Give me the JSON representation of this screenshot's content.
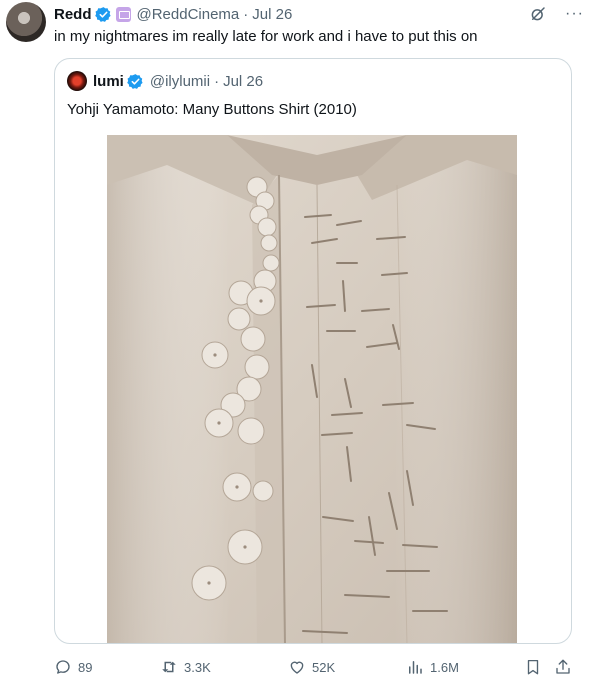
{
  "tweet": {
    "author_name": "Redd",
    "handle": "@ReddCinema",
    "separator": "·",
    "date": "Jul 26",
    "text": "in my nightmares im really late for work and i have to put this on",
    "more": "···"
  },
  "quote": {
    "author_name": "lumi",
    "handle": "@ilylumii",
    "separator": "·",
    "date": "Jul 26",
    "text": "Yohji Yamamoto: Many Buttons Shirt (2010)"
  },
  "actions": {
    "replies": "89",
    "reposts": "3.3K",
    "likes": "52K",
    "views": "1.6M"
  },
  "colors": {
    "verified": "#1d9bf0",
    "muted": "#536471",
    "border": "#cfd9de",
    "shirt": "#d8cfc4"
  },
  "icons": [
    "verified-icon",
    "affiliate-badge-icon",
    "grok-icon",
    "more-icon",
    "reply-icon",
    "repost-icon",
    "like-icon",
    "views-icon",
    "bookmark-icon",
    "share-icon"
  ]
}
